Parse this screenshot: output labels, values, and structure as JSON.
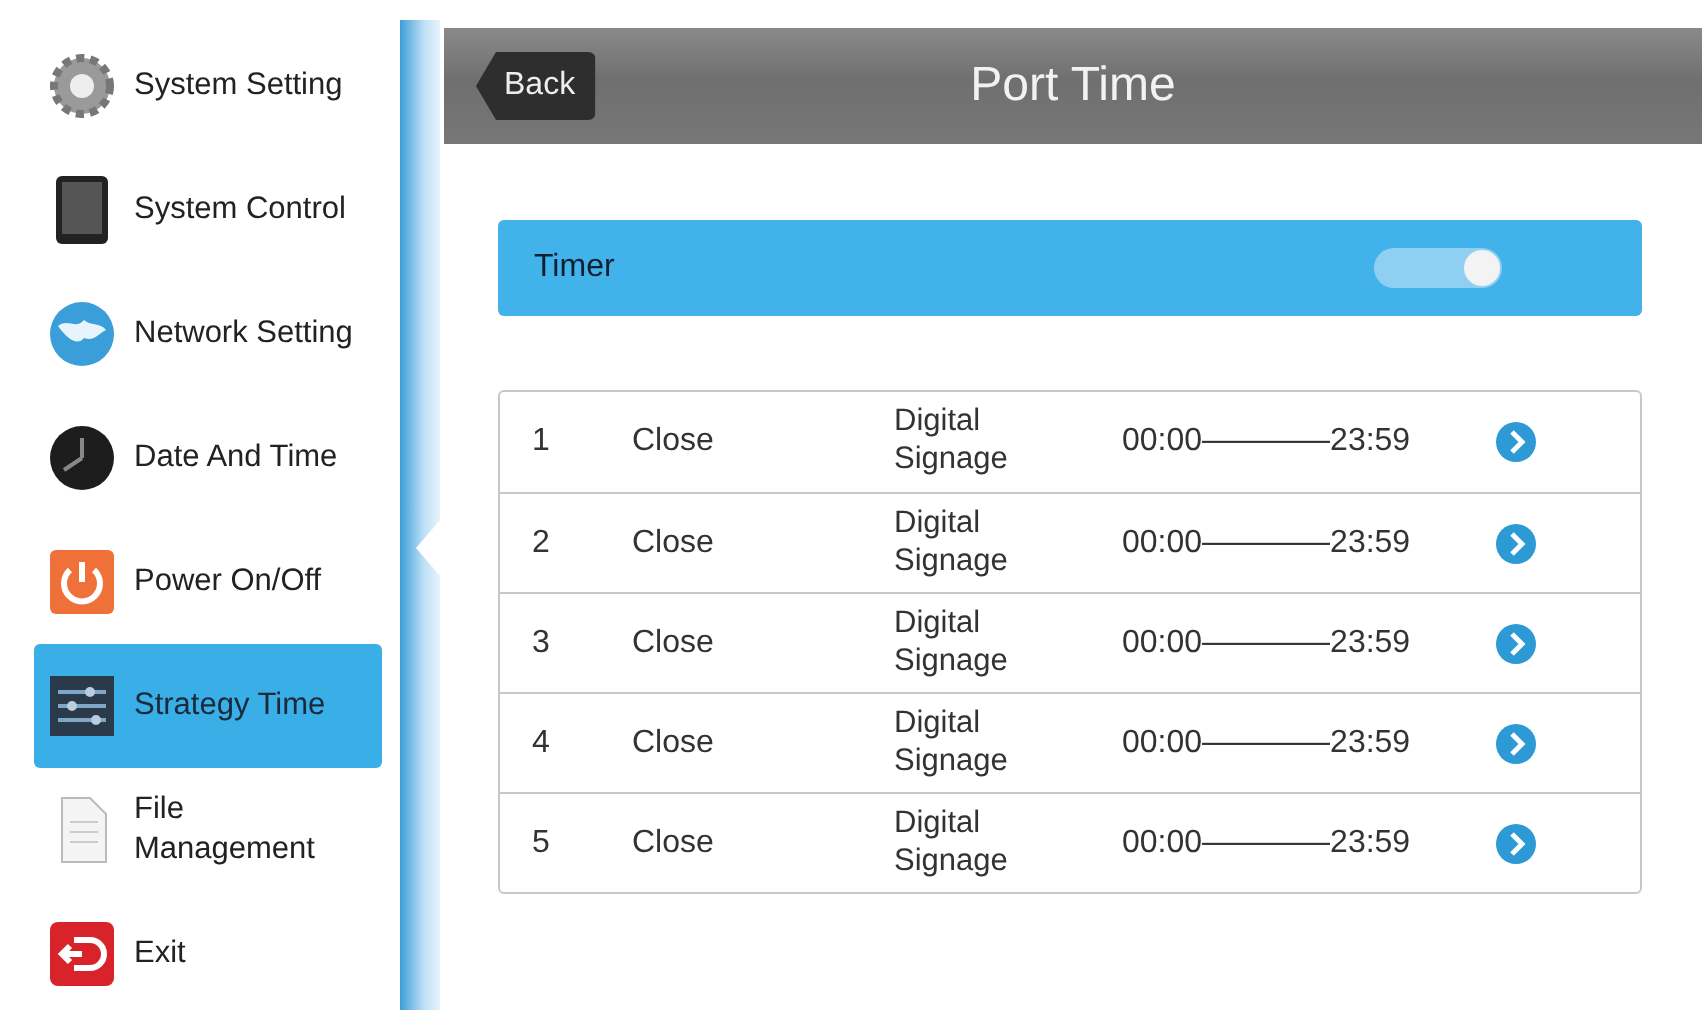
{
  "sidebar": {
    "items": [
      {
        "label": "System Setting",
        "selected": false
      },
      {
        "label": "System Control",
        "selected": false
      },
      {
        "label": "Network Setting",
        "selected": false
      },
      {
        "label": "Date And Time",
        "selected": false
      },
      {
        "label": "Power On/Off",
        "selected": false
      },
      {
        "label": "Strategy Time",
        "selected": true
      },
      {
        "label": "File Management",
        "selected": false
      },
      {
        "label": "Exit",
        "selected": false
      }
    ]
  },
  "header": {
    "back": "Back",
    "title": "Port Time"
  },
  "timer": {
    "label": "Timer",
    "on": true
  },
  "rows": [
    {
      "number": "1",
      "action": "Close",
      "source": "Digital Signage",
      "time": "00:00————23:59"
    },
    {
      "number": "2",
      "action": "Close",
      "source": "Digital Signage",
      "time": "00:00————23:59"
    },
    {
      "number": "3",
      "action": "Close",
      "source": "Digital Signage",
      "time": "00:00————23:59"
    },
    {
      "number": "4",
      "action": "Close",
      "source": "Digital Signage",
      "time": "00:00————23:59"
    },
    {
      "number": "5",
      "action": "Close",
      "source": "Digital Signage",
      "time": "00:00————23:59"
    }
  ]
}
